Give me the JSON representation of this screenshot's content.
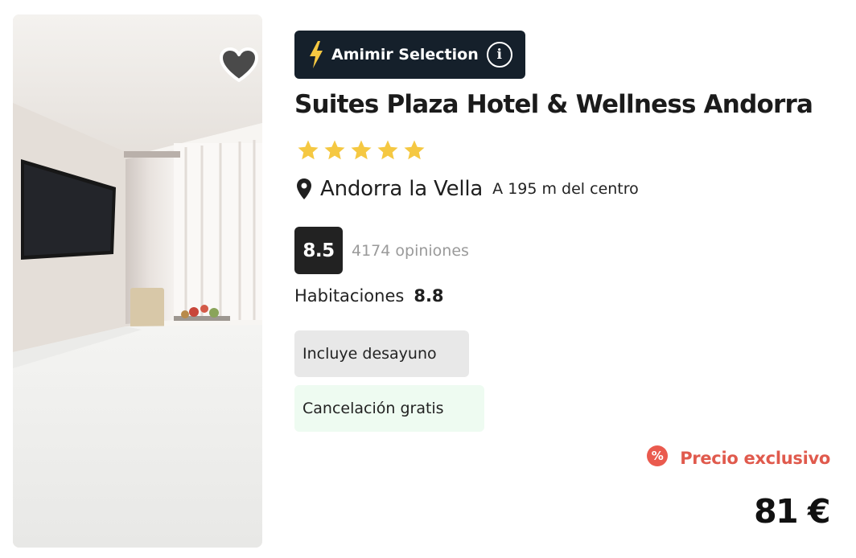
{
  "hotel": {
    "badge": {
      "label": "Amimir Selection",
      "icon": "lightning-icon",
      "info_icon": "info-icon"
    },
    "name": "Suites Plaza Hotel & Wellness Andorra",
    "stars": 5,
    "location": {
      "city": "Andorra la Vella",
      "distance": "A 195 m del centro",
      "icon": "map-pin-icon"
    },
    "rating": {
      "score": "8.5",
      "reviews": "4174 opiniones"
    },
    "rooms": {
      "label": "Habitaciones",
      "score": "8.8"
    },
    "tags": [
      {
        "label": "Incluye desayuno"
      },
      {
        "label": "Cancelación gratis"
      }
    ],
    "promo": {
      "icon_text": "%",
      "label": "Precio exclusivo"
    },
    "price": "81 €",
    "favorite_icon": "heart-icon"
  },
  "colors": {
    "badge_bg": "#15202b",
    "star": "#f5c842",
    "promo": "#e05a4d",
    "score_bg": "#222222",
    "cancel_bg": "#eefbf1",
    "breakfast_bg": "#e8e8e8"
  }
}
